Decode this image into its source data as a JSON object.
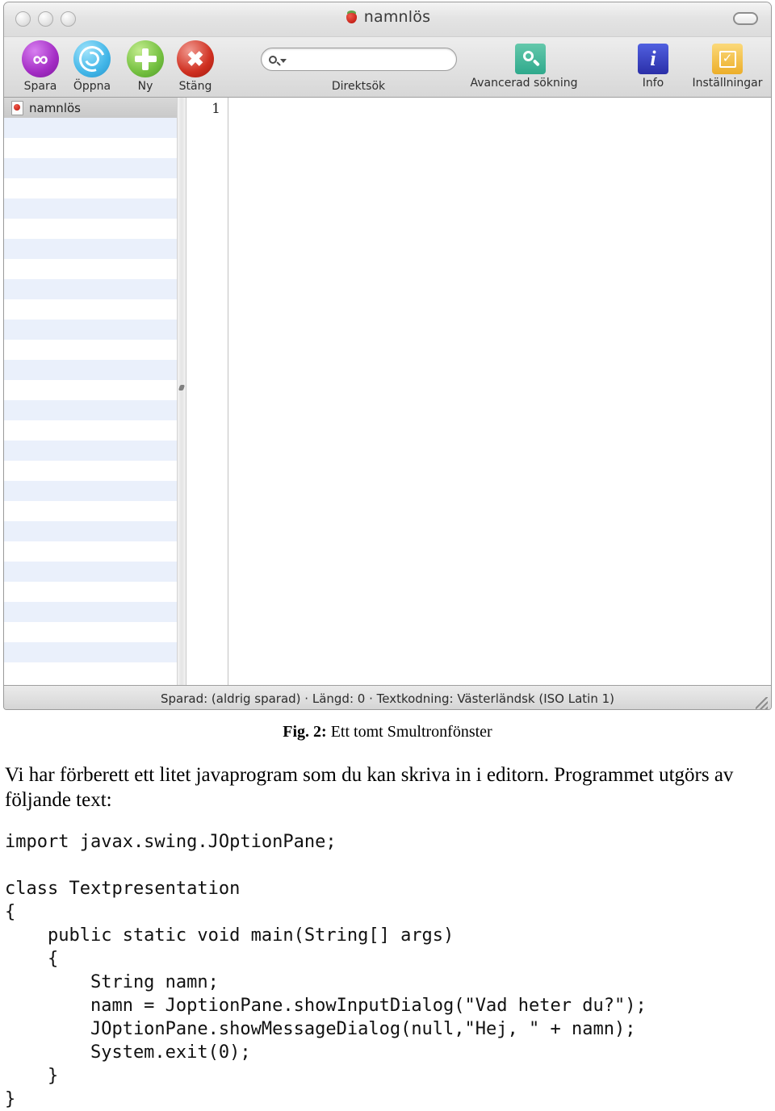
{
  "window": {
    "title": "namnlös",
    "title_icon": "strawberry-icon",
    "traffic_lights": [
      "close",
      "minimize",
      "zoom"
    ],
    "toolbar_toggle_icon": "toolbar-toggle-pill"
  },
  "toolbar": {
    "buttons": [
      {
        "label": "Spara",
        "icon": "infinity-icon",
        "color": "#a32cc4"
      },
      {
        "label": "Öppna",
        "icon": "spiral-icon",
        "color": "#42b6e8"
      },
      {
        "label": "Ny",
        "icon": "plus-icon",
        "color": "#74c040"
      },
      {
        "label": "Stäng",
        "icon": "close-x-icon",
        "color": "#cf2f20"
      },
      {
        "label": "Direktsök",
        "icon": "search-field",
        "color": "#ffffff"
      },
      {
        "label": "Avancerad sökning",
        "icon": "magnifier-icon",
        "color": "#2fa98c"
      },
      {
        "label": "Info",
        "icon": "info-icon",
        "color": "#2b2fa8"
      },
      {
        "label": "Inställningar",
        "icon": "checkbox-icon",
        "color": "#ecae2a"
      }
    ],
    "search": {
      "value": "",
      "placeholder": "",
      "icon": "search-icon",
      "dropdown_icon": "chevron-down-icon"
    }
  },
  "sidebar": {
    "items": [
      {
        "label": "namnlös",
        "icon": "document-icon",
        "selected": true
      }
    ],
    "empty_row_count": 28
  },
  "editor": {
    "line_numbers": [
      "1"
    ],
    "text": ""
  },
  "statusbar": {
    "text": "Sparad: (aldrig sparad)  ·  Längd: 0  ·  Textkodning: Västerländsk (ISO Latin 1)",
    "resize_grip_icon": "resize-grip-icon"
  },
  "document": {
    "figure_label": "Fig. 2:",
    "figure_caption": "Ett tomt Smultronfönster",
    "paragraph": "Vi har förberett ett litet javaprogram som du kan skriva in i editorn. Programmet utgörs av följande text:",
    "code": "import javax.swing.JOptionPane;\n\nclass Textpresentation\n{\n    public static void main(String[] args)\n    {\n        String namn;\n        namn = JoptionPane.showInputDialog(\"Vad heter du?\");\n        JOptionPane.showMessageDialog(null,\"Hej, \" + namn);\n        System.exit(0);\n    }\n}"
  }
}
